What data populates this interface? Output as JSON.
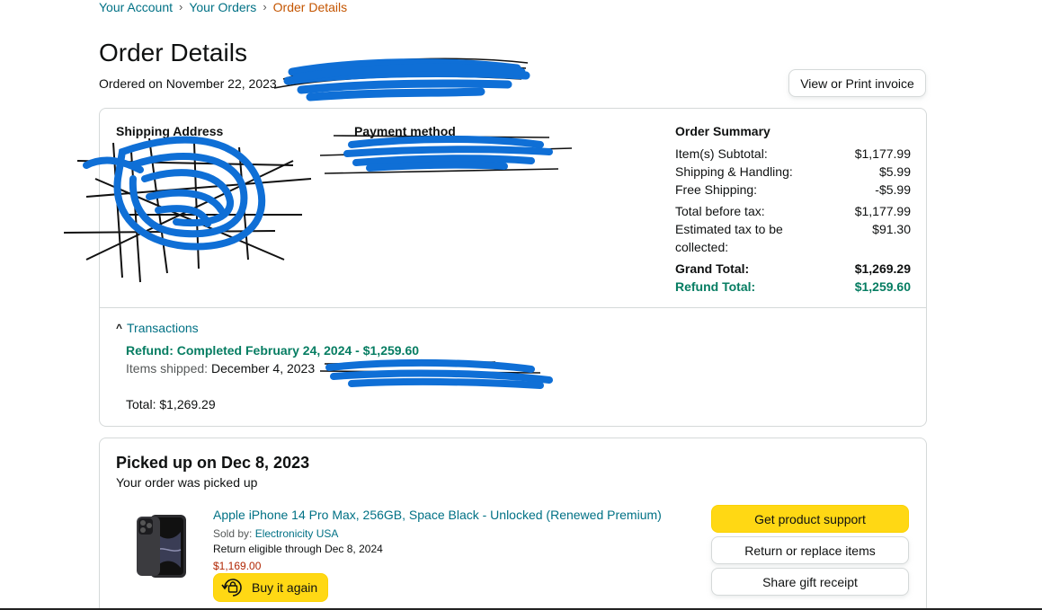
{
  "breadcrumb": {
    "items": [
      "Your Account",
      "Your Orders"
    ],
    "separator": "›",
    "current": "Order Details"
  },
  "page": {
    "title": "Order Details",
    "ordered_on": "Ordered on November 22, 2023",
    "invoice_button": "View or Print invoice"
  },
  "shipping": {
    "heading": "Shipping Address"
  },
  "payment": {
    "heading": "Payment method"
  },
  "summary": {
    "title": "Order Summary",
    "subtotal_label": "Item(s) Subtotal:",
    "subtotal_value": "$1,177.99",
    "shipping_label": "Shipping & Handling:",
    "shipping_value": "$5.99",
    "free_shipping_label": "Free Shipping:",
    "free_shipping_value": "-$5.99",
    "before_tax_label": "Total before tax:",
    "before_tax_value": "$1,177.99",
    "tax_label": "Estimated tax to be collected:",
    "tax_value": "$91.30",
    "grand_total_label": "Grand Total:",
    "grand_total_value": "$1,269.29",
    "refund_total_label": "Refund Total:",
    "refund_total_value": "$1,259.60"
  },
  "transactions": {
    "toggle_label": "Transactions",
    "refund_line": "Refund: Completed February 24, 2024 - $1,259.60",
    "items_shipped_label": "Items shipped:",
    "items_shipped_date": "December 4, 2023",
    "total_line": "Total: $1,269.29"
  },
  "shipment": {
    "status_title": "Picked up on Dec 8, 2023",
    "status_subtitle": "Your order was picked up",
    "product_title": "Apple iPhone 14 Pro Max, 256GB, Space Black - Unlocked (Renewed Premium)",
    "sold_by_label": "Sold by:",
    "seller": "Electronicity USA",
    "return_eligibility": "Return eligible through Dec 8, 2024",
    "price": "$1,169.00",
    "buy_again_label": "Buy it again",
    "actions": {
      "support": "Get product support",
      "return": "Return or replace items",
      "gift": "Share gift receipt"
    }
  },
  "colors": {
    "link": "#007185",
    "breadcrumb_current": "#c45500",
    "refund_green": "#067d62",
    "price_red": "#b12704",
    "primary_button": "#ffd814",
    "redaction_blue": "#0f6fd6"
  }
}
